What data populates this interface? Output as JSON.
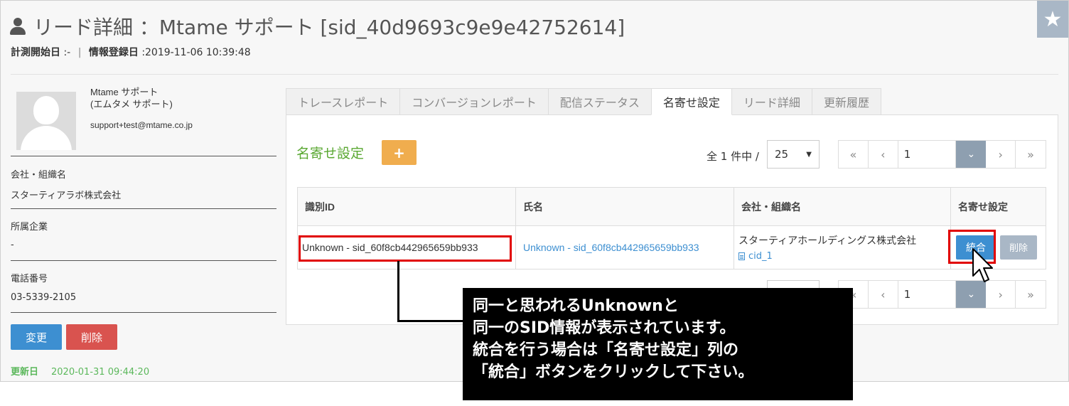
{
  "header": {
    "title": "リード詳細 ：Mtame サポート [sid_40d9693c9e9e42752614]",
    "meta_start_label": "計測開始日",
    "meta_start_value": ":-",
    "meta_separator": "|",
    "meta_registered_label": "情報登録日",
    "meta_registered_value": ":2019-11-06 10:39:48"
  },
  "profile": {
    "name_line1": "Mtame サポート",
    "name_line2": "(エムタメ サポート)",
    "email": "support+test@mtame.co.jp",
    "fields": [
      {
        "label": "会社・組織名",
        "value": "スターティアラボ株式会社"
      },
      {
        "label": "所属企業",
        "value": "-"
      },
      {
        "label": "電話番号",
        "value": "03-5339-2105"
      }
    ],
    "edit_label": "変更",
    "delete_label": "削除",
    "updated_label": "更新日",
    "updated_value": "2020-01-31 09:44:20"
  },
  "tabs": [
    "トレースレポート",
    "コンバージョンレポート",
    "配信ステータス",
    "名寄せ設定",
    "リード詳細",
    "更新履歴"
  ],
  "active_tab": "名寄せ設定",
  "section": {
    "title": "名寄せ設定",
    "add_label": "+",
    "count_text": "全 1 件中 /",
    "per_page": "25",
    "page": "1"
  },
  "pager": {
    "first": "«",
    "prev": "‹",
    "next": "›",
    "last": "»",
    "dropdown": "⌄"
  },
  "table": {
    "headers": [
      "識別ID",
      "氏名",
      "会社・組織名",
      "名寄せ設定"
    ],
    "rows": [
      {
        "id": "Unknown - sid_60f8cb442965659bb933",
        "name": "Unknown - sid_60f8cb442965659bb933",
        "company": "スターティアホールディングス株式会社",
        "cid": "cid_1",
        "merge_label": "統合",
        "delete_label": "削除"
      }
    ]
  },
  "callout": {
    "lines": [
      "同一と思われるUnknownと",
      "同一のSID情報が表示されています。",
      "統合を行う場合は「名寄せ設定」列の",
      "「統合」ボタンをクリックして下さい。"
    ]
  },
  "colors": {
    "primary": "#3d8fd1",
    "danger": "#d9534f",
    "warning": "#f0ad4e",
    "success": "#5aa832",
    "highlight": "#e10000"
  }
}
